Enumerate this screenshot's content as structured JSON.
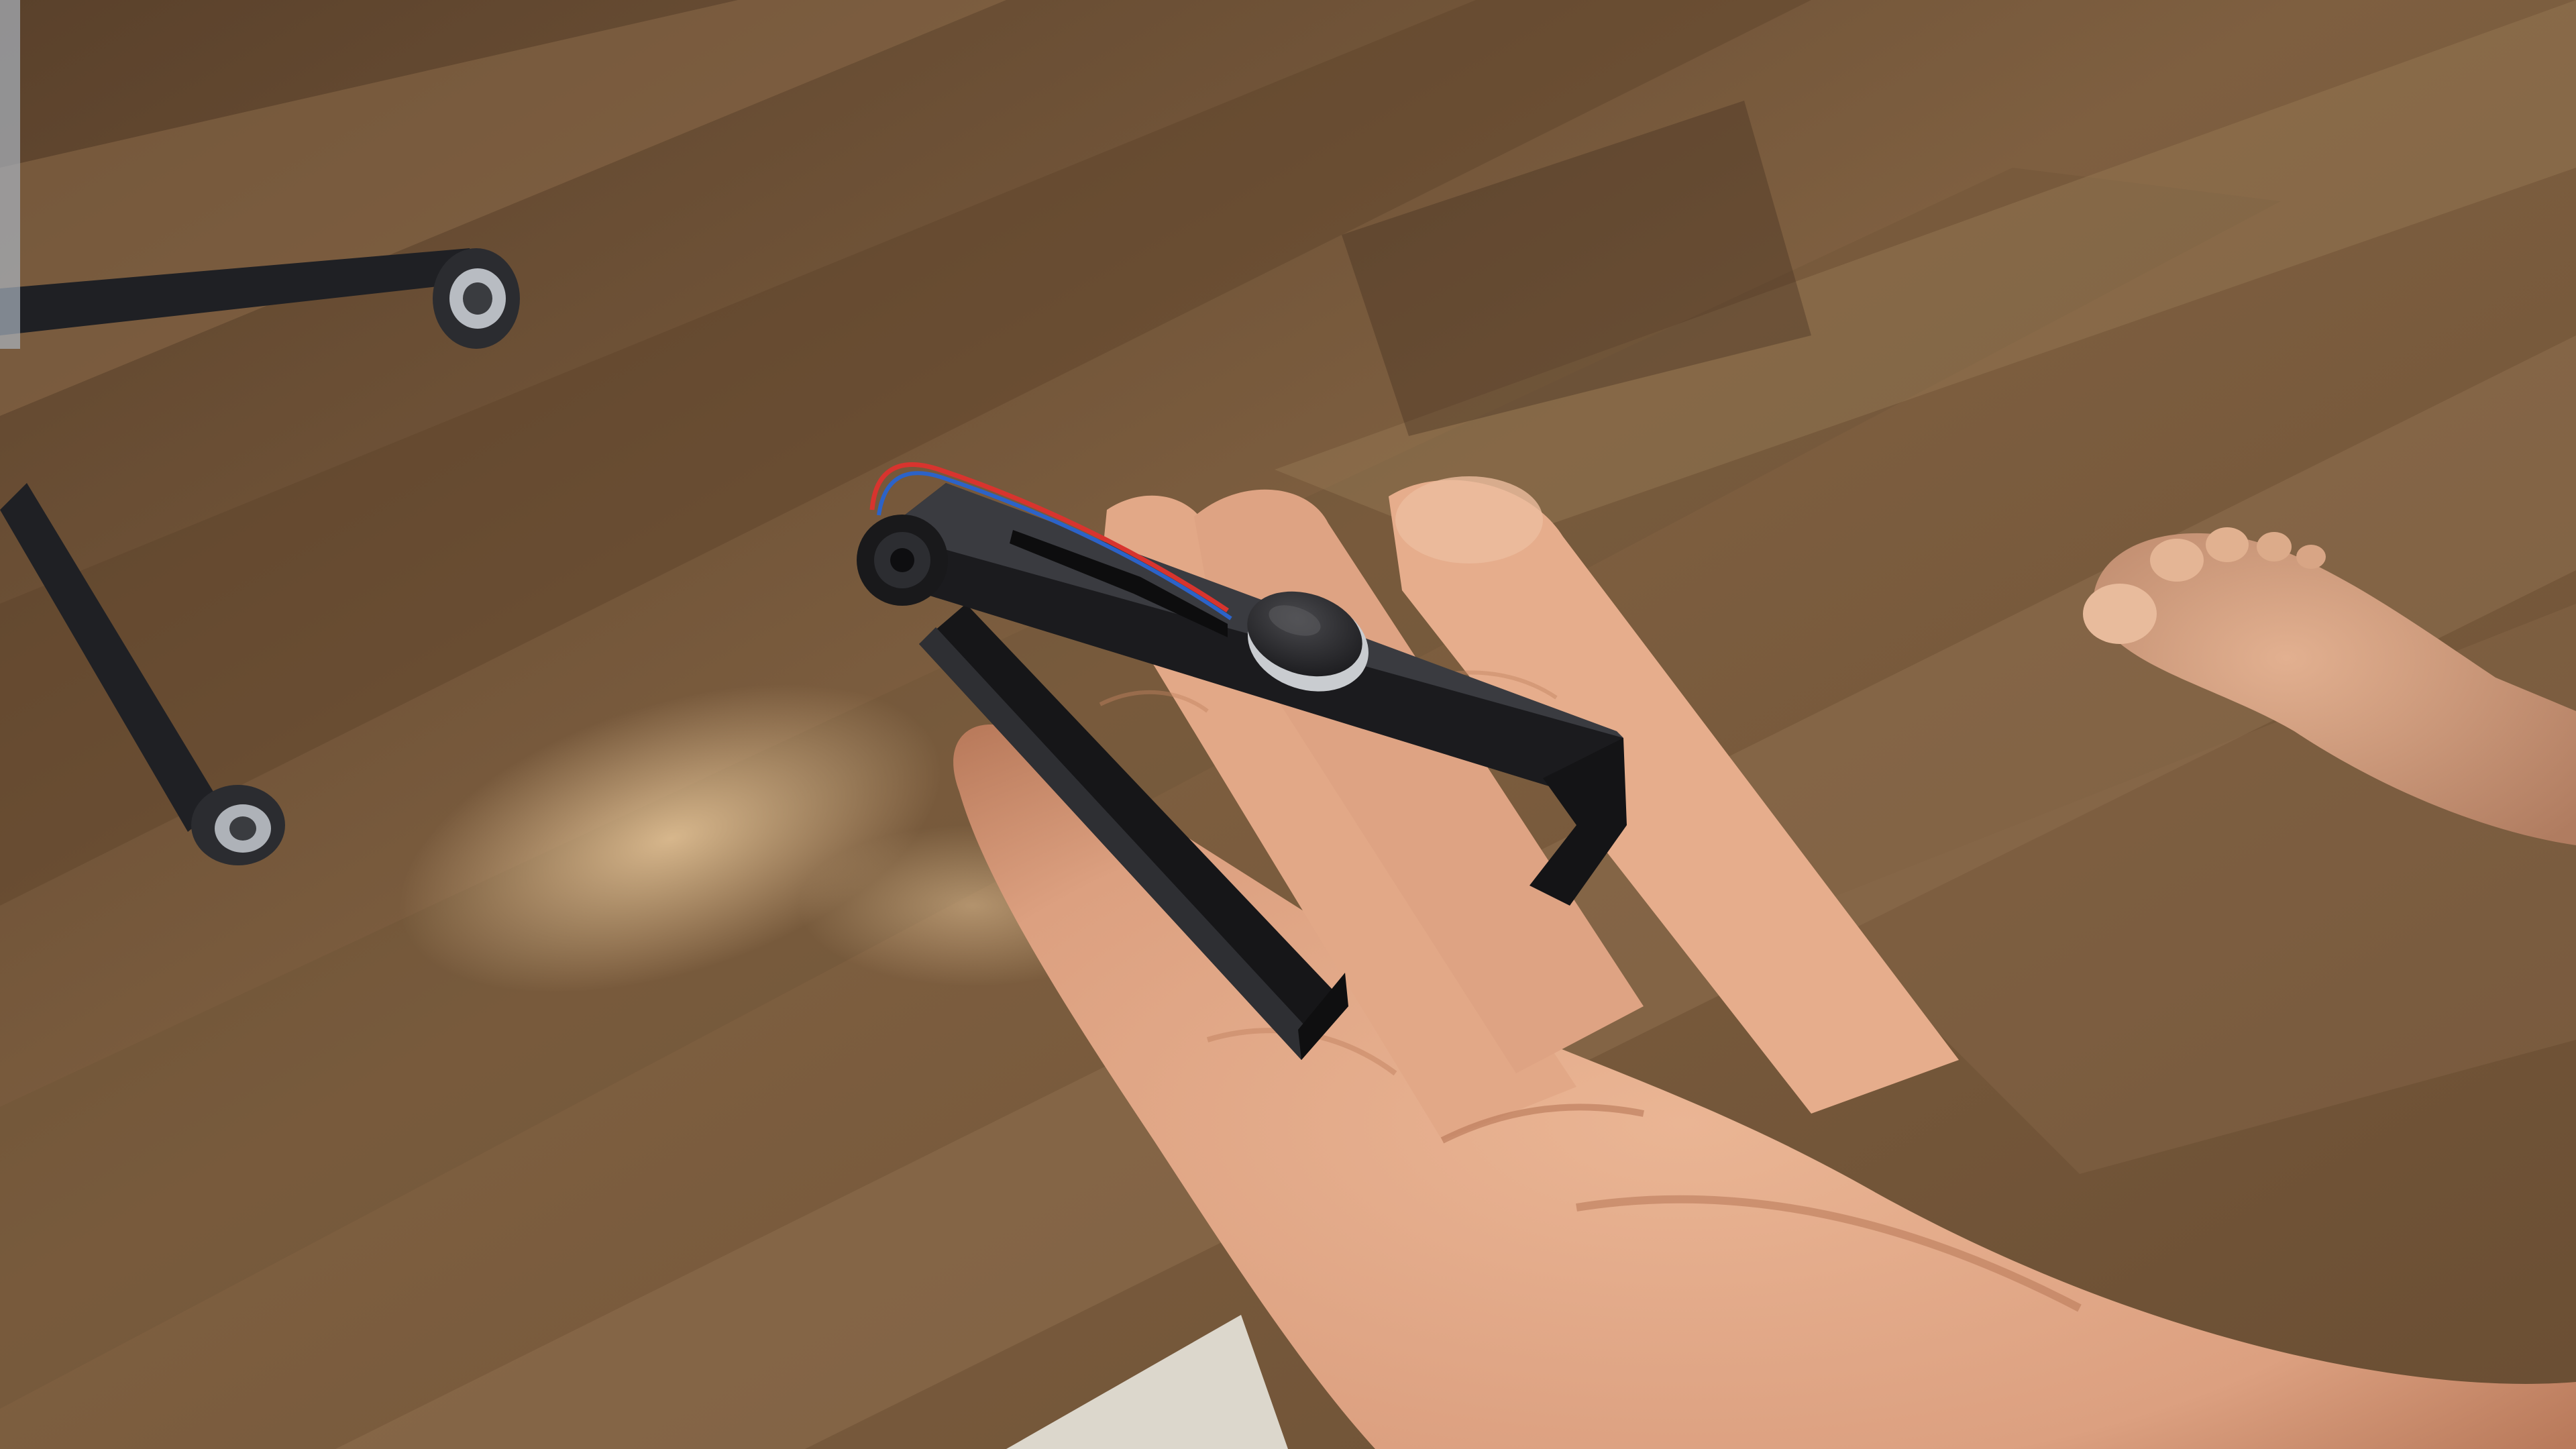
{
  "image": {
    "kind": "photograph",
    "subject_parts": [
      "wooden-floor",
      "chair-base",
      "hand",
      "folding-3d-printed-bracket",
      "coin-vibration-motor",
      "wire",
      "bare-foot",
      "doorway-light"
    ]
  },
  "colors": {
    "floor_dark": "#4a3522",
    "floor_mid": "#7a5b3c",
    "floor_light": "#a5845e",
    "plastic": "#1b1b1e",
    "plastic_highlight": "#3a3b40",
    "motor_face": "#2a2a2c",
    "motor_rim": "#b9bcc0",
    "skin": "#e3a987",
    "skin_shadow": "#c48464",
    "wire_red": "#d8342e",
    "wire_blue": "#2c63c8",
    "chair_metal": "#222428"
  }
}
